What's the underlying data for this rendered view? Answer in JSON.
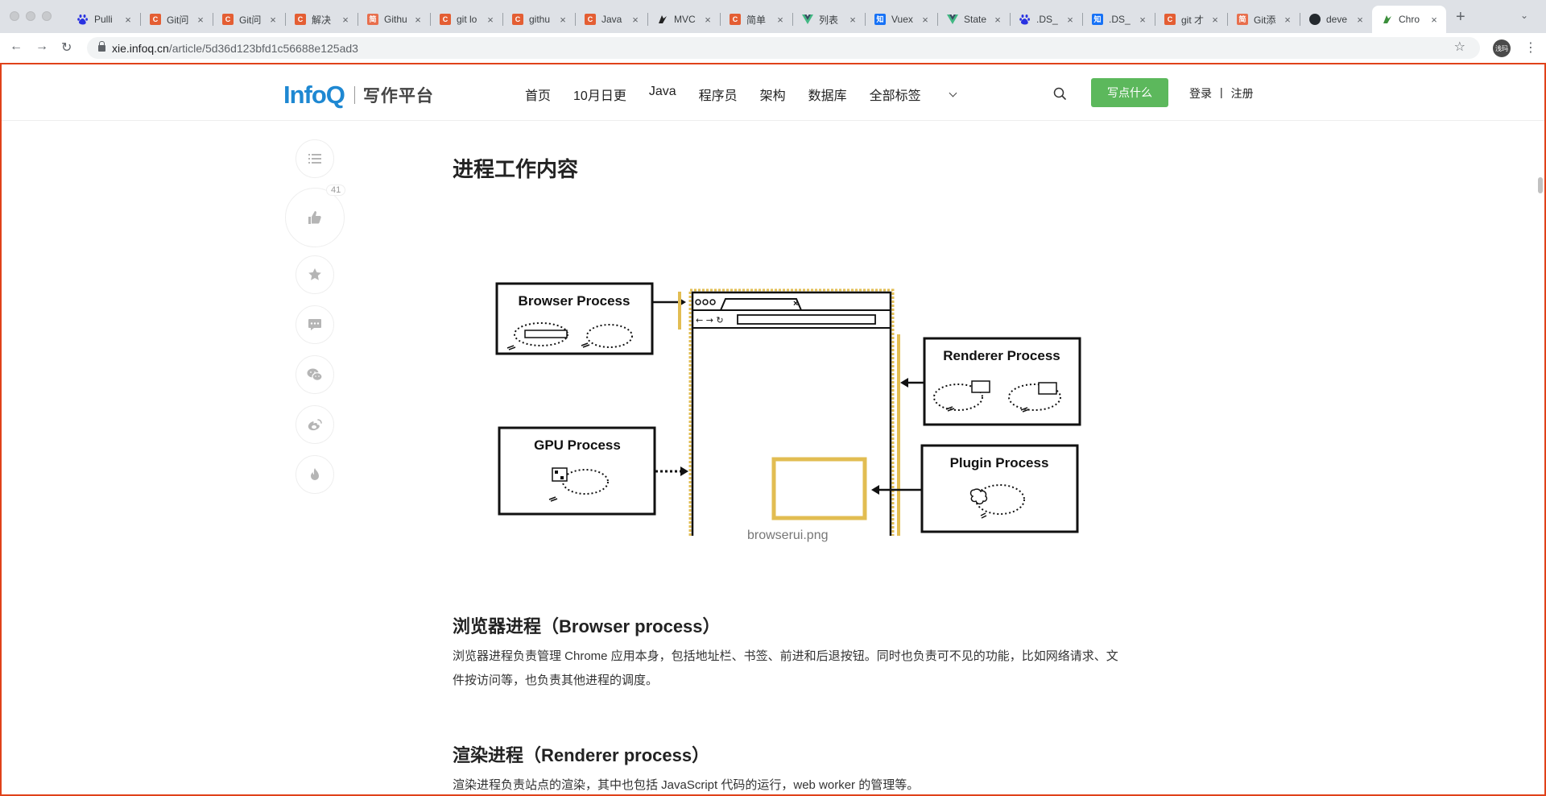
{
  "browser": {
    "tabs": [
      {
        "title": "Pulli",
        "icon": "baidu-icon"
      },
      {
        "title": "Git问",
        "icon": "csdn-icon"
      },
      {
        "title": "Git问",
        "icon": "csdn-icon"
      },
      {
        "title": "解决",
        "icon": "csdn-icon"
      },
      {
        "title": "Githu",
        "icon": "jianshu-icon"
      },
      {
        "title": "git lo",
        "icon": "csdn-icon"
      },
      {
        "title": "githu",
        "icon": "csdn-icon"
      },
      {
        "title": "Java",
        "icon": "csdn-icon"
      },
      {
        "title": "MVC",
        "icon": "mvc-icon"
      },
      {
        "title": "简单",
        "icon": "csdn-icon"
      },
      {
        "title": "列表",
        "icon": "vue-icon"
      },
      {
        "title": "Vuex",
        "icon": "zhihu-icon"
      },
      {
        "title": "State",
        "icon": "vue-icon"
      },
      {
        "title": ".DS_",
        "icon": "baidu-icon"
      },
      {
        "title": ".DS_",
        "icon": "zhihu-icon"
      },
      {
        "title": "git 才",
        "icon": "csdn-icon"
      },
      {
        "title": "Git添",
        "icon": "jianshu-icon"
      },
      {
        "title": "deve",
        "icon": "github-icon"
      },
      {
        "title": "Chro",
        "icon": "chrome-ext-icon",
        "active": true
      }
    ],
    "fav_letters": {
      "csdn": "C",
      "jianshu": "简",
      "zhihu": "知"
    },
    "url_host": "xie.infoq.cn",
    "url_path": "/article/5d36d123bfd1c56688e125ad3",
    "profile_label": "浅玛"
  },
  "site": {
    "logo_brand": "InfoQ",
    "logo_sub": "写作平台",
    "nav": [
      "首页",
      "10月日更",
      "Java",
      "程序员",
      "架构",
      "数据库",
      "全部标签"
    ],
    "write_button": "写点什么",
    "login": "登录",
    "separator": "|",
    "register": "注册"
  },
  "side": {
    "like_count": "41"
  },
  "article": {
    "section_title": "进程工作内容",
    "diagram": {
      "browser_process": "Browser Process",
      "gpu_process": "GPU Process",
      "renderer_process": "Renderer Process",
      "plugin_process": "Plugin Process"
    },
    "caption": "browserui.png",
    "browser_heading": "浏览器进程（Browser process）",
    "browser_text": "浏览器进程负责管理 Chrome 应用本身，包括地址栏、书签、前进和后退按钮。同时也负责可不见的功能，比如网络请求、文件按访问等，也负责其他进程的调度。",
    "renderer_heading": "渲染进程（Renderer process）",
    "renderer_text": "渲染进程负责站点的渲染，其中也包括 JavaScript 代码的运行，web worker 的管理等。"
  },
  "colors": {
    "accent_green": "#5cb85c",
    "infoq_blue": "#1e88d2",
    "highlight_yellow": "#e2bd52",
    "frame_red": "#e0421a"
  }
}
